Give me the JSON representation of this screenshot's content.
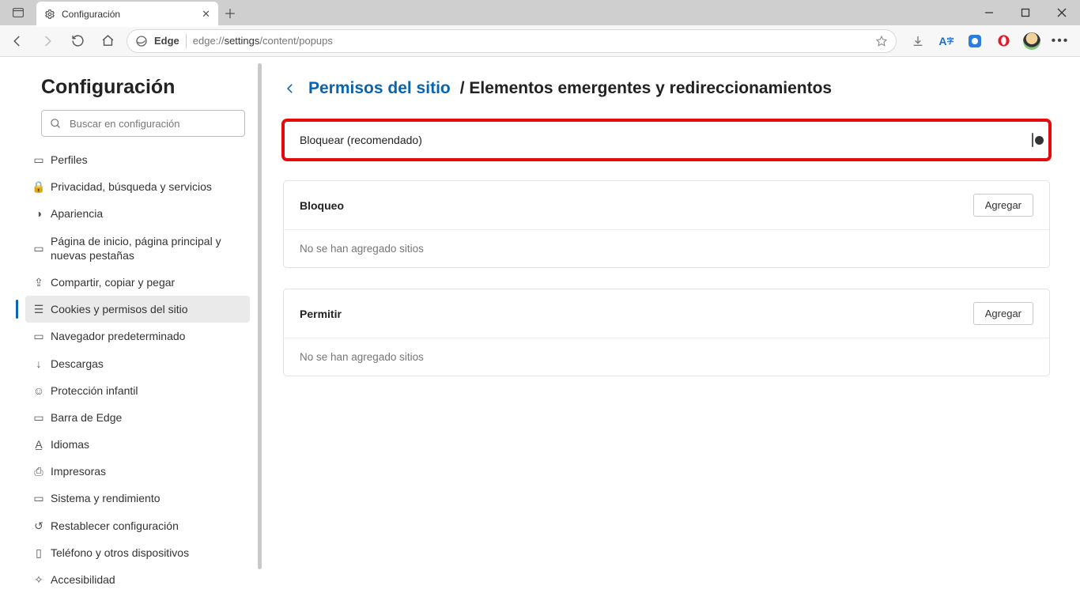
{
  "window": {
    "tab_title": "Configuración"
  },
  "toolbar": {
    "edge_label": "Edge",
    "url_prefix": "edge://",
    "url_bold": "settings",
    "url_suffix": "/content/popups"
  },
  "sidebar": {
    "title": "Configuración",
    "search_placeholder": "Buscar en configuración",
    "items": [
      {
        "label": "Perfiles"
      },
      {
        "label": "Privacidad, búsqueda y servicios"
      },
      {
        "label": "Apariencia"
      },
      {
        "label": "Página de inicio, página principal y nuevas pestañas"
      },
      {
        "label": "Compartir, copiar y pegar"
      },
      {
        "label": "Cookies y permisos del sitio"
      },
      {
        "label": "Navegador predeterminado"
      },
      {
        "label": "Descargas"
      },
      {
        "label": "Protección infantil"
      },
      {
        "label": "Barra de Edge"
      },
      {
        "label": "Idiomas"
      },
      {
        "label": "Impresoras"
      },
      {
        "label": "Sistema y rendimiento"
      },
      {
        "label": "Restablecer configuración"
      },
      {
        "label": "Teléfono y otros dispositivos"
      },
      {
        "label": "Accesibilidad"
      }
    ]
  },
  "main": {
    "breadcrumb_link": "Permisos del sitio",
    "breadcrumb_sep": " / ",
    "breadcrumb_current": "Elementos emergentes y redireccionamientos",
    "block_toggle_label": "Bloquear (recomendado)",
    "section_block": "Bloqueo",
    "section_allow": "Permitir",
    "add_button": "Agregar",
    "empty_text": "No se han agregado sitios"
  }
}
